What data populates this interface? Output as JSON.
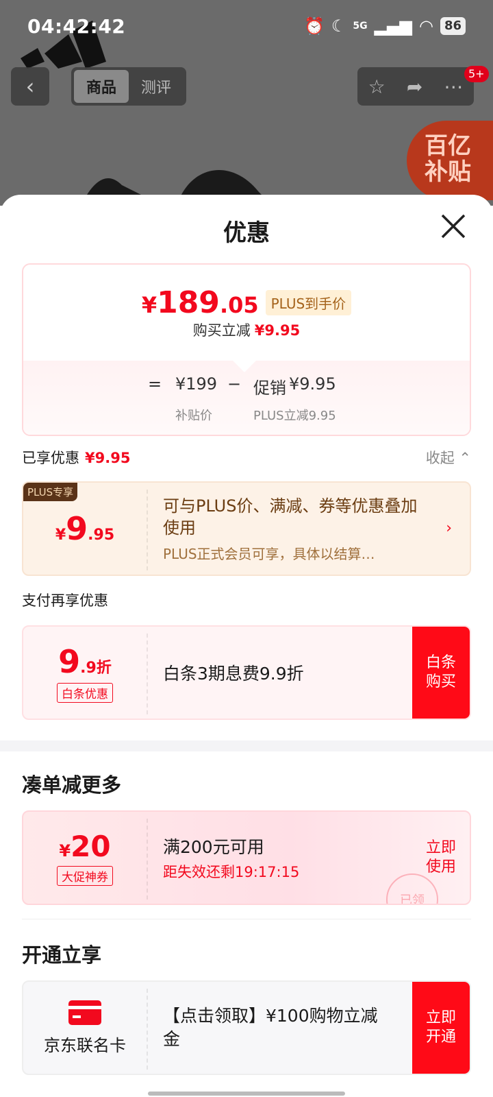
{
  "status_bar": {
    "time": "04:42:42",
    "network": "5G",
    "battery": "86"
  },
  "product_nav": {
    "back_icon": "chevron-left-icon",
    "tabs": [
      {
        "label": "商品",
        "active": true
      },
      {
        "label": "测评",
        "active": false
      }
    ],
    "actions": [
      "star-icon",
      "share-icon",
      "more-icon"
    ],
    "badge": "5+"
  },
  "subsidy_badge": {
    "line1": "百亿",
    "line2": "补贴"
  },
  "sheet": {
    "title": "优惠",
    "close_icon": "close-icon",
    "price_card": {
      "yen": "¥",
      "price_int": "189",
      "price_dec": ".05",
      "tag": "PLUS到手价",
      "sub_label": "购买立减",
      "sub_value": "¥9.95",
      "formula": {
        "equals": "=",
        "subsidy_price": "¥199",
        "minus": "−",
        "promo_label": "促销",
        "promo_value": "¥9.95",
        "subsidy_caption": "补贴价",
        "promo_caption": "PLUS立减9.95"
      }
    },
    "enjoyed": {
      "label": "已享优惠",
      "value": "¥9.95",
      "collapse": "收起"
    },
    "plus_coupon": {
      "ribbon": "PLUS专享",
      "yen": "¥",
      "amount_int": "9",
      "amount_dec": ".95",
      "title": "可与PLUS价、满减、券等优惠叠加使用",
      "desc": "PLUS正式会员可享，具体以结算…",
      "arrow": "›"
    },
    "pay_title": "支付再享优惠",
    "baitiao_coupon": {
      "amount_int": "9",
      "amount_dec": ".9折",
      "tag": "白条优惠",
      "title": "白条3期息费9.9折",
      "button": "白条购买"
    },
    "bundle_title": "凑单减更多",
    "promo_coupon": {
      "yen": "¥",
      "amount": "20",
      "tag": "大促神券",
      "title": "满200元可用",
      "countdown": "距失效还剩19:17:15",
      "button": "立即使用",
      "stamp": "已领"
    },
    "open_title": "开通立享",
    "card_coupon": {
      "icon": "credit-card-icon",
      "name": "京东联名卡",
      "title": "【点击领取】¥100购物立减金",
      "button": "立即开通"
    }
  },
  "colors": {
    "accent_red": "#f2091e",
    "button_red": "#ff0a17",
    "plus_brown": "#5a3318"
  }
}
